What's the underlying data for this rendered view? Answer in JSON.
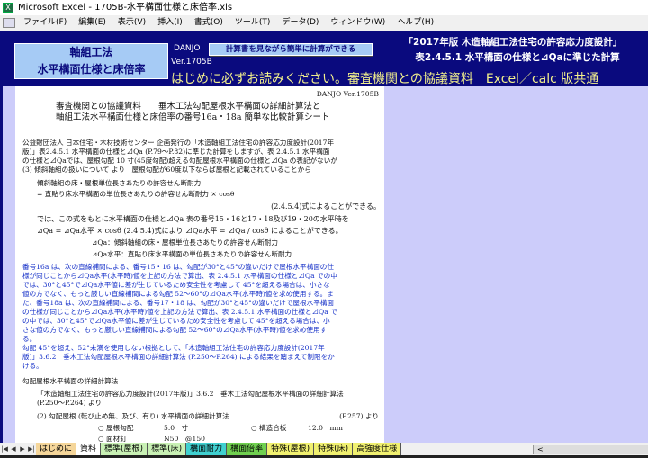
{
  "window": {
    "title": "Microsoft Excel - 1705B-水平構面仕様と床倍率.xls"
  },
  "menu": [
    "ファイル(F)",
    "編集(E)",
    "表示(V)",
    "挿入(I)",
    "書式(O)",
    "ツール(T)",
    "データ(D)",
    "ウィンドウ(W)",
    "ヘルプ(H)"
  ],
  "header": {
    "logo_line1": "軸組工法",
    "logo_line2": "水平構面仕様と床倍率",
    "danjo": "DANJO",
    "version": "Ver.1705B",
    "calc_button": "計算書を見ながら簡単に計算ができる",
    "right_title1": "「2017年版 木造軸組工法住宅の許容応力度設計」",
    "right_title2": "表2.4.5.1 水平構面の仕様と⊿Qaに準じた計算",
    "banner": "はじめに必ずお読みください。審査機関との協議資料　Excel／calc 版共通"
  },
  "page": {
    "version": "DANJO Ver.1705B",
    "title1": "審査機関との協議資料　　垂木工法勾配屋根水平構面の詳細計算法と",
    "title2": "軸組工法水平構面仕様と床倍率の番号16a・18a 簡単な比較計算シート",
    "intro": [
      "公益財団法人 日本住宅・木材技術センター 企画発行の「木造軸組工法住宅の許容応力度設計(2017年",
      "版)」表2.4.5.1 水平構面の仕様と⊿Qa (P.79～P.82)に準じた計算をしますが、表 2.4.5.1 水平構面",
      "の仕様と⊿Qaでは、屋根勾配 10 寸(45度勾配)超える勾配屋根水平構面の仕様と⊿Qa の表記がないが",
      "(3) 傾斜軸組の扱いについて より　屋根勾配が60度以下ならば屋根と記載されていることから"
    ],
    "formula": [
      "傾斜軸組の床・屋根単位長さあたりの許容せん断耐力",
      "= 直貼り床水平構面の単位長さあたりの許容せん断耐力 × cosθ",
      "(2.4.5.4)式によることができる。",
      "では、この式をもとに水平構面の仕様と⊿Qa 表の番号15・16と17・18及び19・20の水平時を",
      "⊿Qa = ⊿Qa水平 × cosθ (2.4.5.4)式により ⊿Qa水平 = ⊿Qa / cosθ によることができる。",
      "⊿Qa：傾斜軸組の床・屋根単位長さあたりの許容せん断耐力",
      "⊿Qa水平：直貼り床水平構面の単位長さあたりの許容せん断耐力"
    ],
    "blue": [
      "番号16a は、次の直線補間による、番号15・16 は、勾配が30°と45°の違いだけで屋根水平構面の仕",
      "様が同じことから⊿Qa水平(水平時)値を上記の方法で算出、表 2.4.5.1 水平構面の仕様と⊿Qa での中",
      "では、30°と45°で⊿Qa水平値に差が生じているため安全性を考慮して 45°を超える場合は、小さな",
      "値の方でなく、もっと厳しい直線補間による勾配 52～60°の⊿Qa水平(水平時)値を求め使用する。ま",
      "た、番号18a は、次の直線補間による、番号17・18 は、勾配が30°と45°の違いだけで屋根水平構面",
      "の仕様が同じことから⊿Qa水平(水平時)値を上記の方法で算出、表 2.4.5.1 水平構面の仕様と⊿Qa で",
      "の中では、30°と45°で⊿Qa水平値に差が生じているため安全性を考慮して 45°を超える場合は、小",
      "さな値の方でなく、もっと厳しい直線補間による勾配 52～60°の⊿Qa水平(水平時)値を求め使用す",
      "る。",
      "勾配 45°を超え、52°未満を使用しない根拠として、「木造軸組工法住宅の許容応力度設計(2017年",
      "版)」3.6.2　垂木工法勾配屋根水平構面の詳細計算法 (P.250～P.264) による結果を踏まえて制限をか",
      "ける。"
    ],
    "section": "勾配屋根水平構面の詳細計算法",
    "ref1": "「木造軸組工法住宅の許容応力度設計(2017年版)」3.6.2　垂木工法勾配屋根水平構面の詳細計算法",
    "ref2": "(P.250～P.264) より",
    "sub": "(2) 勾配屋根 (転び止め無、及び、有り) 水平構面の詳細計算法",
    "sub_page": "(P.257) より",
    "items": [
      {
        "label": "○ 屋根勾配",
        "value": "5.0　寸"
      },
      {
        "label": "○ 構造合板",
        "value": "12.0　mm"
      },
      {
        "label": "○ 面材釘",
        "value": "N50　@150"
      }
    ]
  },
  "tabs": [
    {
      "label": "はじめに",
      "color": "#f5d69a"
    },
    {
      "label": "資料",
      "color": "#ffffff"
    },
    {
      "label": "標準(屋根)",
      "color": "#c8f0b4"
    },
    {
      "label": "標準(床)",
      "color": "#c8f0b4"
    },
    {
      "label": "構面耐力",
      "color": "#40d0d0"
    },
    {
      "label": "構面倍率",
      "color": "#70d050"
    },
    {
      "label": "特殊(屋根)",
      "color": "#f0f070"
    },
    {
      "label": "特殊(床)",
      "color": "#f0f070"
    },
    {
      "label": "高強度仕様",
      "color": "#f0f070"
    }
  ],
  "scroll_left": "<"
}
